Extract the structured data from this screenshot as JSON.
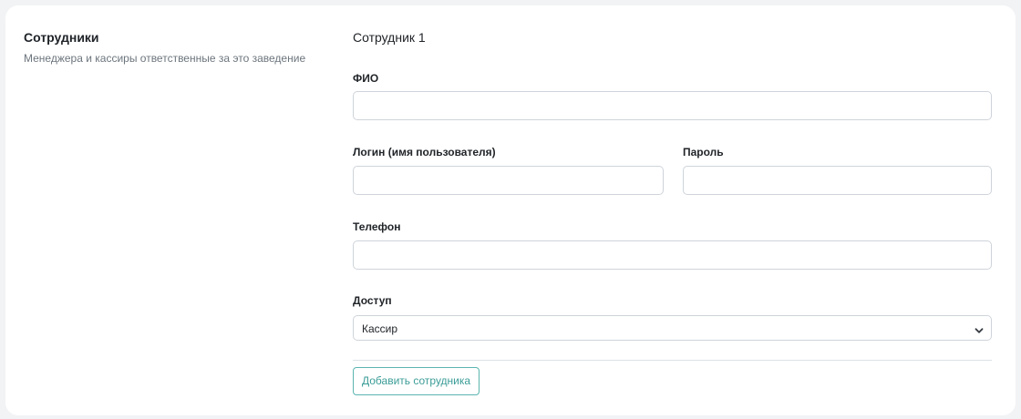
{
  "section": {
    "title": "Сотрудники",
    "description": "Менеджера и кассиры ответственные за это заведение"
  },
  "employee": {
    "heading": "Сотрудник 1",
    "fields": {
      "full_name": {
        "label": "ФИО",
        "value": "",
        "placeholder": ""
      },
      "login": {
        "label": "Логин (имя пользователя)",
        "value": "",
        "placeholder": ""
      },
      "password": {
        "label": "Пароль",
        "value": "",
        "placeholder": ""
      },
      "phone": {
        "label": "Телефон",
        "value": "",
        "placeholder": ""
      },
      "access": {
        "label": "Доступ",
        "selected": "Кассир"
      }
    }
  },
  "actions": {
    "add_employee_label": "Добавить сотрудника"
  },
  "icons": {
    "select_chevron": "chevron-down-icon"
  },
  "colors": {
    "accent": "#3a9c97",
    "accent_border": "#5bb5b0",
    "page_background": "#f2f3f5",
    "card_background": "#ffffff",
    "muted_text": "#6c757d",
    "input_border": "#ced4da"
  }
}
